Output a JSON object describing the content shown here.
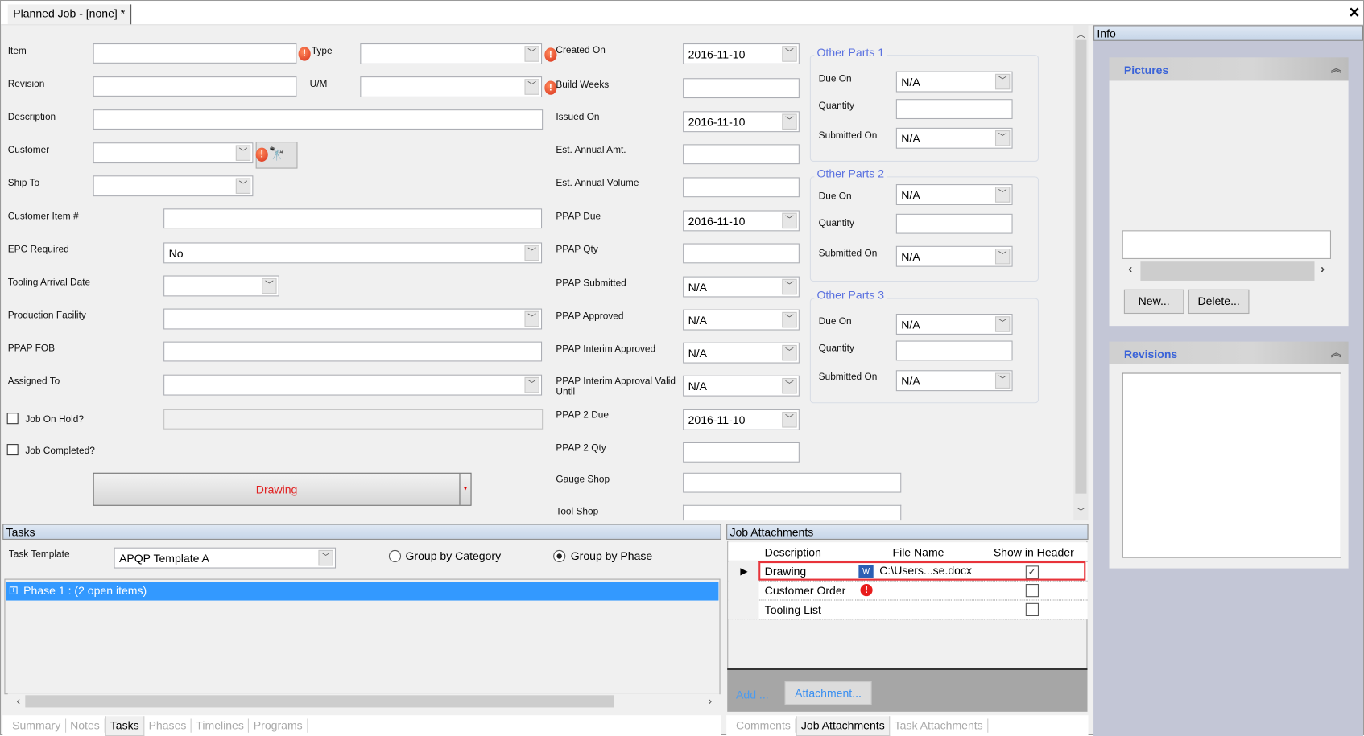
{
  "window": {
    "tab_title": "Planned Job - [none] *",
    "close_icon": "close-icon"
  },
  "form_left": {
    "item": {
      "label": "Item",
      "value": ""
    },
    "type": {
      "label": "Type",
      "value": ""
    },
    "revision": {
      "label": "Revision",
      "value": ""
    },
    "um": {
      "label": "U/M",
      "value": ""
    },
    "description": {
      "label": "Description",
      "value": ""
    },
    "customer": {
      "label": "Customer",
      "value": ""
    },
    "ship_to": {
      "label": "Ship To",
      "value": ""
    },
    "customer_item": {
      "label": "Customer Item #",
      "value": ""
    },
    "epc_required": {
      "label": "EPC Required",
      "value": "No"
    },
    "tooling_arrival": {
      "label": "Tooling Arrival Date",
      "value": ""
    },
    "production_facility": {
      "label": "Production Facility",
      "value": ""
    },
    "ppap_fob": {
      "label": "PPAP FOB",
      "value": ""
    },
    "assigned_to": {
      "label": "Assigned To",
      "value": ""
    },
    "job_on_hold": {
      "label": "Job On Hold?",
      "checked": false
    },
    "job_completed": {
      "label": "Job Completed?",
      "checked": false
    },
    "drawing_button": "Drawing"
  },
  "form_mid": {
    "created_on": {
      "label": "Created On",
      "value": "2016-11-10"
    },
    "build_weeks": {
      "label": "Build Weeks",
      "value": ""
    },
    "issued_on": {
      "label": "Issued On",
      "value": "2016-11-10"
    },
    "est_annual_amt": {
      "label": "Est. Annual Amt.",
      "value": ""
    },
    "est_annual_volume": {
      "label": "Est. Annual Volume",
      "value": ""
    },
    "ppap_due": {
      "label": "PPAP Due",
      "value": "2016-11-10"
    },
    "ppap_qty": {
      "label": "PPAP Qty",
      "value": ""
    },
    "ppap_submitted": {
      "label": "PPAP Submitted",
      "value": "N/A"
    },
    "ppap_approved": {
      "label": "PPAP Approved",
      "value": "N/A"
    },
    "ppap_interim_approved": {
      "label": "PPAP Interim Approved",
      "value": "N/A"
    },
    "ppap_interim_valid_until": {
      "label1": "PPAP Interim Approval Valid",
      "label2": "Until",
      "value": "N/A"
    },
    "ppap2_due": {
      "label": "PPAP 2 Due",
      "value": "2016-11-10"
    },
    "ppap2_qty": {
      "label": "PPAP 2 Qty",
      "value": ""
    },
    "gauge_shop": {
      "label": "Gauge Shop",
      "value": ""
    },
    "tool_shop": {
      "label": "Tool Shop",
      "value": ""
    }
  },
  "other_parts": [
    {
      "title": "Other Parts 1",
      "due_label": "Due On",
      "due": "N/A",
      "qty_label": "Quantity",
      "qty": "",
      "sub_label": "Submitted On",
      "sub": "N/A"
    },
    {
      "title": "Other Parts 2",
      "due_label": "Due On",
      "due": "N/A",
      "qty_label": "Quantity",
      "qty": "",
      "sub_label": "Submitted On",
      "sub": "N/A"
    },
    {
      "title": "Other Parts 3",
      "due_label": "Due On",
      "due": "N/A",
      "qty_label": "Quantity",
      "qty": "",
      "sub_label": "Submitted On",
      "sub": "N/A"
    }
  ],
  "tasks": {
    "header": "Tasks",
    "template_label": "Task Template",
    "template_value": "APQP Template A",
    "radio_category": "Group by Category",
    "radio_phase": "Group by Phase",
    "selected_radio": "Group by Phase",
    "rows": [
      "Phase 1 : (2 open items)"
    ],
    "tabs": [
      "Summary",
      "Notes",
      "Tasks",
      "Phases",
      "Timelines",
      "Programs"
    ],
    "active_tab": "Tasks"
  },
  "attachments": {
    "header": "Job Attachments",
    "columns": [
      "Description",
      "File Name",
      "Show in Header"
    ],
    "rows": [
      {
        "description": "Drawing",
        "file": "C:\\Users...se.docx",
        "show": true,
        "icon": "word-doc-icon"
      },
      {
        "description": "Customer Order",
        "file": "",
        "show": false,
        "icon": "error-icon"
      },
      {
        "description": "Tooling List",
        "file": "",
        "show": false
      }
    ],
    "add_label": "Add ...",
    "attachment_button": "Attachment...",
    "tabs": [
      "Comments",
      "Job Attachments",
      "Task Attachments"
    ],
    "active_tab": "Job Attachments"
  },
  "info": {
    "header": "Info",
    "pictures": {
      "title": "Pictures",
      "new_button": "New...",
      "delete_button": "Delete..."
    },
    "revisions": {
      "title": "Revisions"
    }
  },
  "colors": {
    "accent": "#3399ff",
    "group_title": "#5b72e0",
    "error": "#e0301a",
    "highlight_border": "#e8333a"
  }
}
